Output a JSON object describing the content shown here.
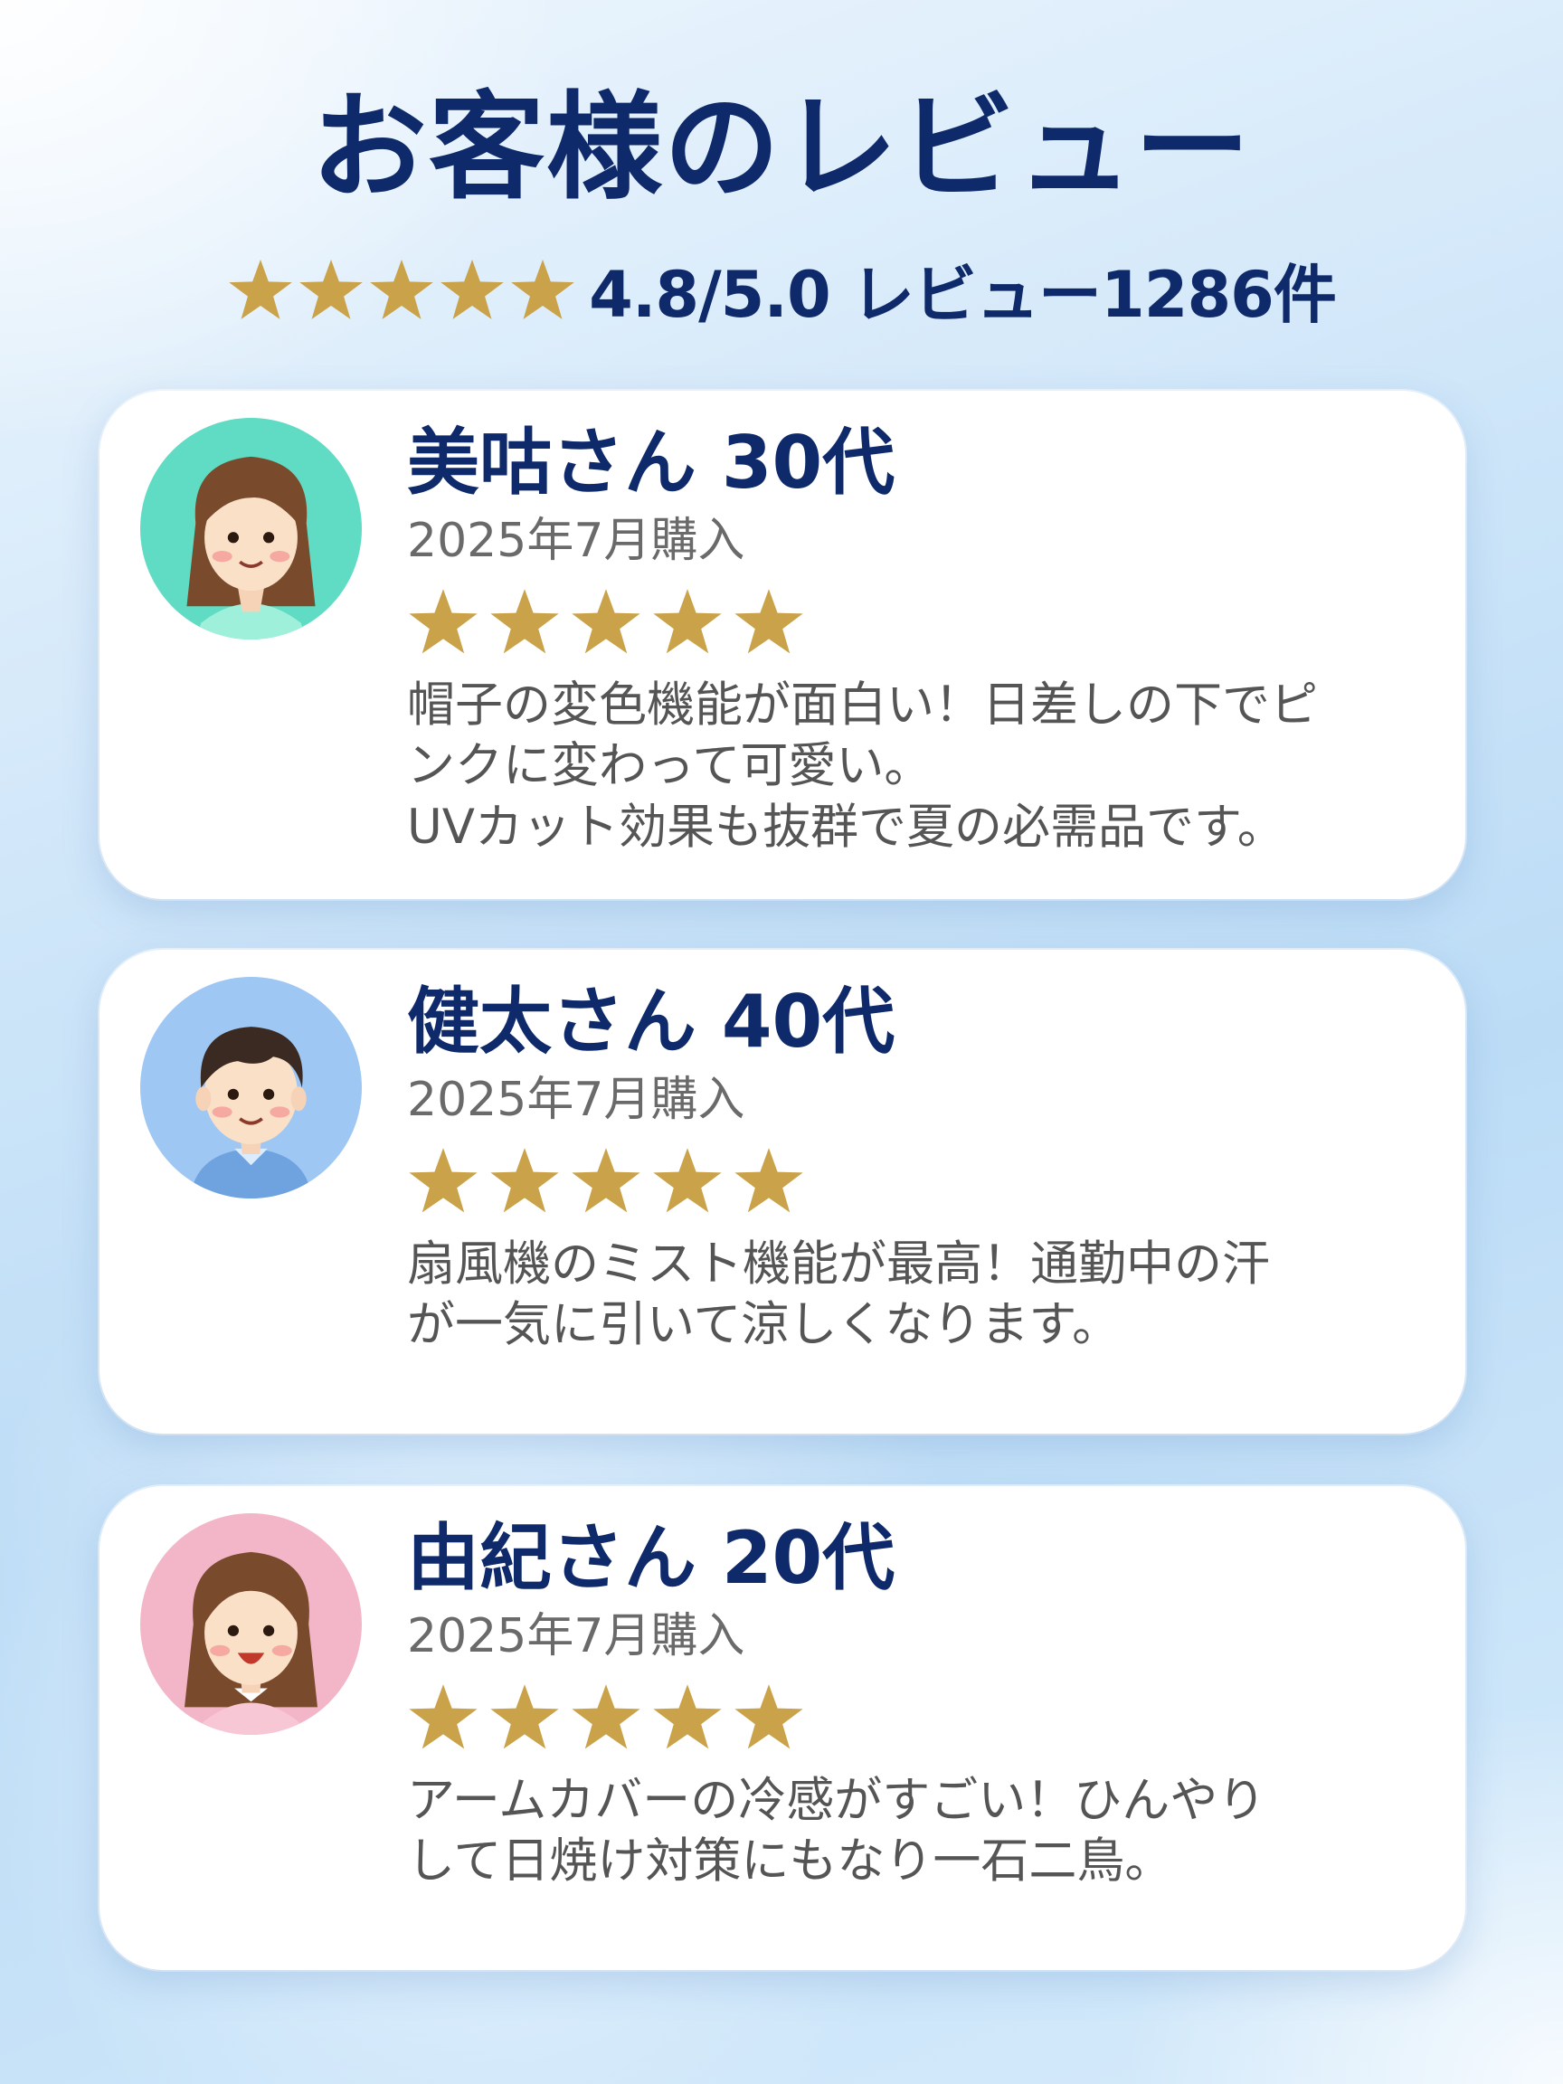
{
  "header": {
    "title": "お客様のレビュー",
    "rating_stars": 5,
    "rating_text": "4.8/5.0 レビュー1286件"
  },
  "colors": {
    "title": "#0f2a6b",
    "star": "#c9a24a",
    "avatar1_bg": "#5fdcc3",
    "avatar2_bg": "#9ec7f3",
    "avatar3_bg": "#f3b6c8"
  },
  "reviews": [
    {
      "name": "美咕さん 30代",
      "date": "2025年7月購入",
      "stars": 5,
      "text": "帽子の変色機能が面白い！日差しの下でピ\nンクに変わって可愛い。\nUVカット効果も抜群で夏の必需品です。",
      "avatar_icon": "woman-avatar-icon"
    },
    {
      "name": "健太さん 40代",
      "date": "2025年7月購入",
      "stars": 5,
      "text": "扇風機のミスト機能が最高！通勤中の汗\nが一気に引いて涼しくなります。",
      "avatar_icon": "man-avatar-icon"
    },
    {
      "name": "由紀さん 20代",
      "date": "2025年7月購入",
      "stars": 5,
      "text": "アームカバーの冷感がすごい！ひんやり\nして日焼け対策にもなり一石二鳥。",
      "avatar_icon": "girl-avatar-icon"
    }
  ]
}
